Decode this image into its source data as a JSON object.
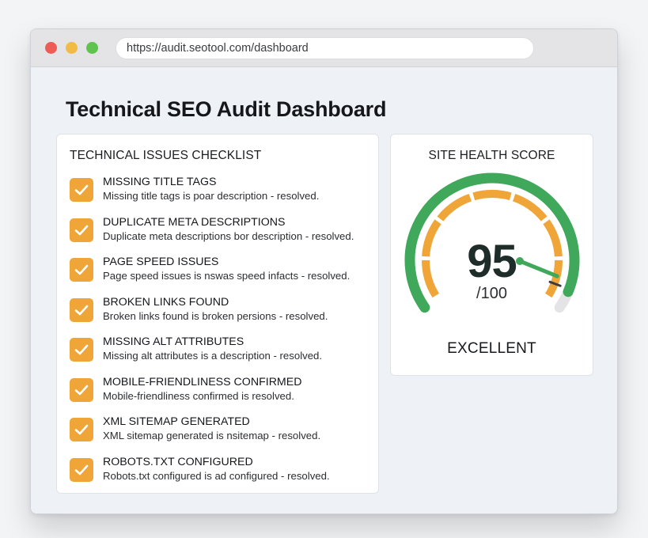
{
  "browser": {
    "url": "https://audit.seotool.com/dashboard"
  },
  "page": {
    "title": "Technical SEO Audit Dashboard"
  },
  "checklist": {
    "title": "TECHNICAL ISSUES CHECKLIST",
    "items": [
      {
        "title": "MISSING TITLE TAGS",
        "description": "Missing title tags is poar description - resolved.",
        "checked": true
      },
      {
        "title": "DUPLICATE META DESCRIPTIONS",
        "description": "Duplicate meta descriptions bor description - resolved.",
        "checked": true
      },
      {
        "title": "PAGE SPEED ISSUES",
        "description": "Page speed issues is nswas speed infacts - resolved.",
        "checked": true
      },
      {
        "title": "BROKEN LINKS FOUND",
        "description": "Broken links found is broken persions - resolved.",
        "checked": true
      },
      {
        "title": "MISSING ALT ATTRIBUTES",
        "description": "Missing alt attributes is a description - resolved.",
        "checked": true
      },
      {
        "title": "MOBILE-FRIENDLINESS CONFIRMED",
        "description": "Mobile-friendliness confirmed is resolved.",
        "checked": true
      },
      {
        "title": "XML SITEMAP GENERATED",
        "description": "XML sitemap generated is nsitemap - resolved.",
        "checked": true
      },
      {
        "title": "ROBOTS.TXT CONFIGURED",
        "description": "Robots.txt configured is ad configured - resolved.",
        "checked": true
      }
    ]
  },
  "health": {
    "title": "SITE HEALTH SCORE",
    "score": "95",
    "max": "/100",
    "score_fraction": 0.95,
    "rating": "EXCELLENT",
    "colors": {
      "outer_arc": "#3fa85a",
      "inner_arc": "#f0a539",
      "needle": "#3fa85a",
      "score_text": "#1f2d2a",
      "track": "#e4e4e6"
    }
  },
  "colors": {
    "checkbox": "#f0a539",
    "window_bg": "#eef1f6",
    "traffic_red": "#ee5c57",
    "traffic_yellow": "#f2bb44",
    "traffic_green": "#5ec44e"
  }
}
